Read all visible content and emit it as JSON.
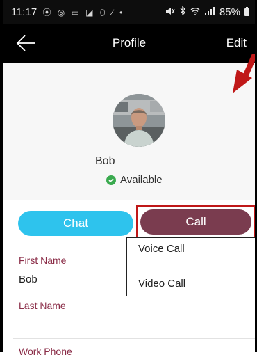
{
  "status_bar": {
    "time": "11:17",
    "notifications": "⦿ ◎ ▭ ◪ ⬯ ∕ •",
    "battery_percent": "85%"
  },
  "app_bar": {
    "title": "Profile",
    "edit_label": "Edit"
  },
  "profile": {
    "name": "Bob",
    "presence": "Available",
    "presence_color": "#3aaa4f"
  },
  "actions": {
    "chat_label": "Chat",
    "call_label": "Call",
    "chat_color": "#2ec3ed",
    "call_color": "#7a3c4f"
  },
  "call_menu": {
    "items": [
      {
        "label": "Voice Call"
      },
      {
        "label": "Video Call"
      }
    ]
  },
  "fields": [
    {
      "label": "First Name",
      "value": "Bob"
    },
    {
      "label": "Last Name",
      "value": ""
    },
    {
      "label": "Work Phone",
      "value": ""
    }
  ],
  "annotation": {
    "highlight_color": "#c01818"
  }
}
